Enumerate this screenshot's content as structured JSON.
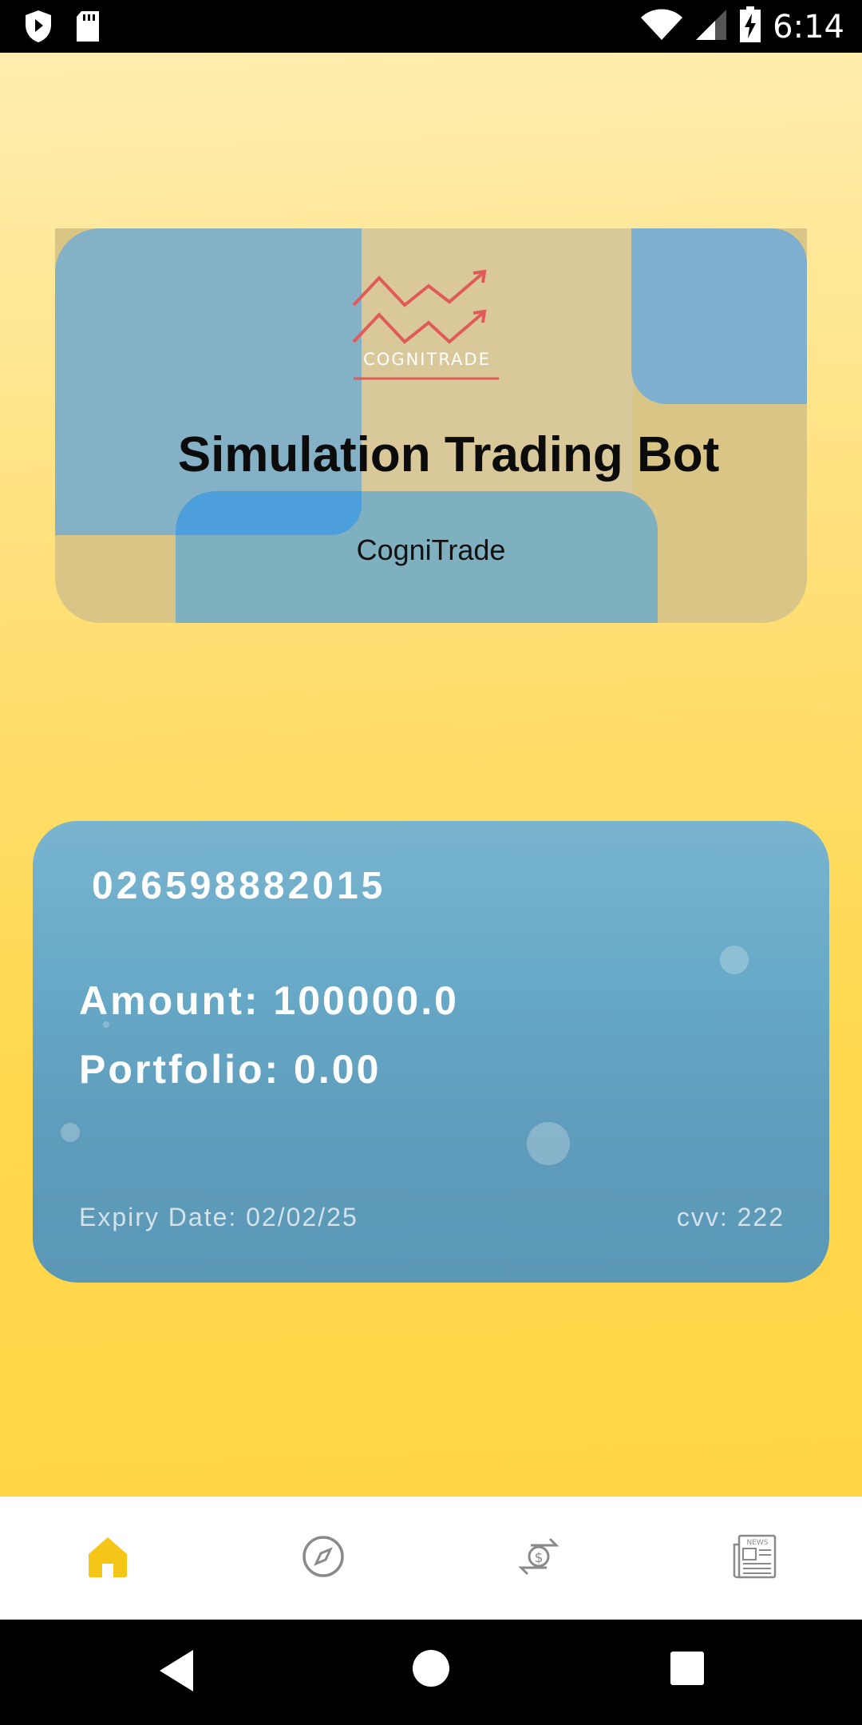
{
  "status_bar": {
    "time": "6:14",
    "icons": [
      "shield-icon",
      "sd-card-icon",
      "wifi-icon",
      "signal-icon",
      "battery-charging-icon"
    ]
  },
  "hero": {
    "logo_text": "COGNITRADE",
    "title": "Simulation Trading Bot",
    "subtitle": "CogniTrade",
    "colors": {
      "logo": "#e05a5a",
      "tile_blue": "#7fb0c8",
      "tile_sand": "#d9c89a"
    }
  },
  "account_card": {
    "account_number": "026598882015",
    "amount": "Amount: 100000.0",
    "portfolio": "Portfolio: 0.00",
    "expiry": "Expiry Date: 02/02/25",
    "cvv": "cvv: 222"
  },
  "bottom_nav": {
    "items": [
      {
        "icon": "home-icon",
        "active": true
      },
      {
        "icon": "compass-icon",
        "active": false
      },
      {
        "icon": "exchange-dollar-icon",
        "active": false
      },
      {
        "icon": "news-icon",
        "active": false
      }
    ],
    "active_color": "#f5c518",
    "inactive_color": "#8a8a8a"
  },
  "system_nav": {
    "icons": [
      "back-icon",
      "home-circle-icon",
      "recents-icon"
    ]
  }
}
